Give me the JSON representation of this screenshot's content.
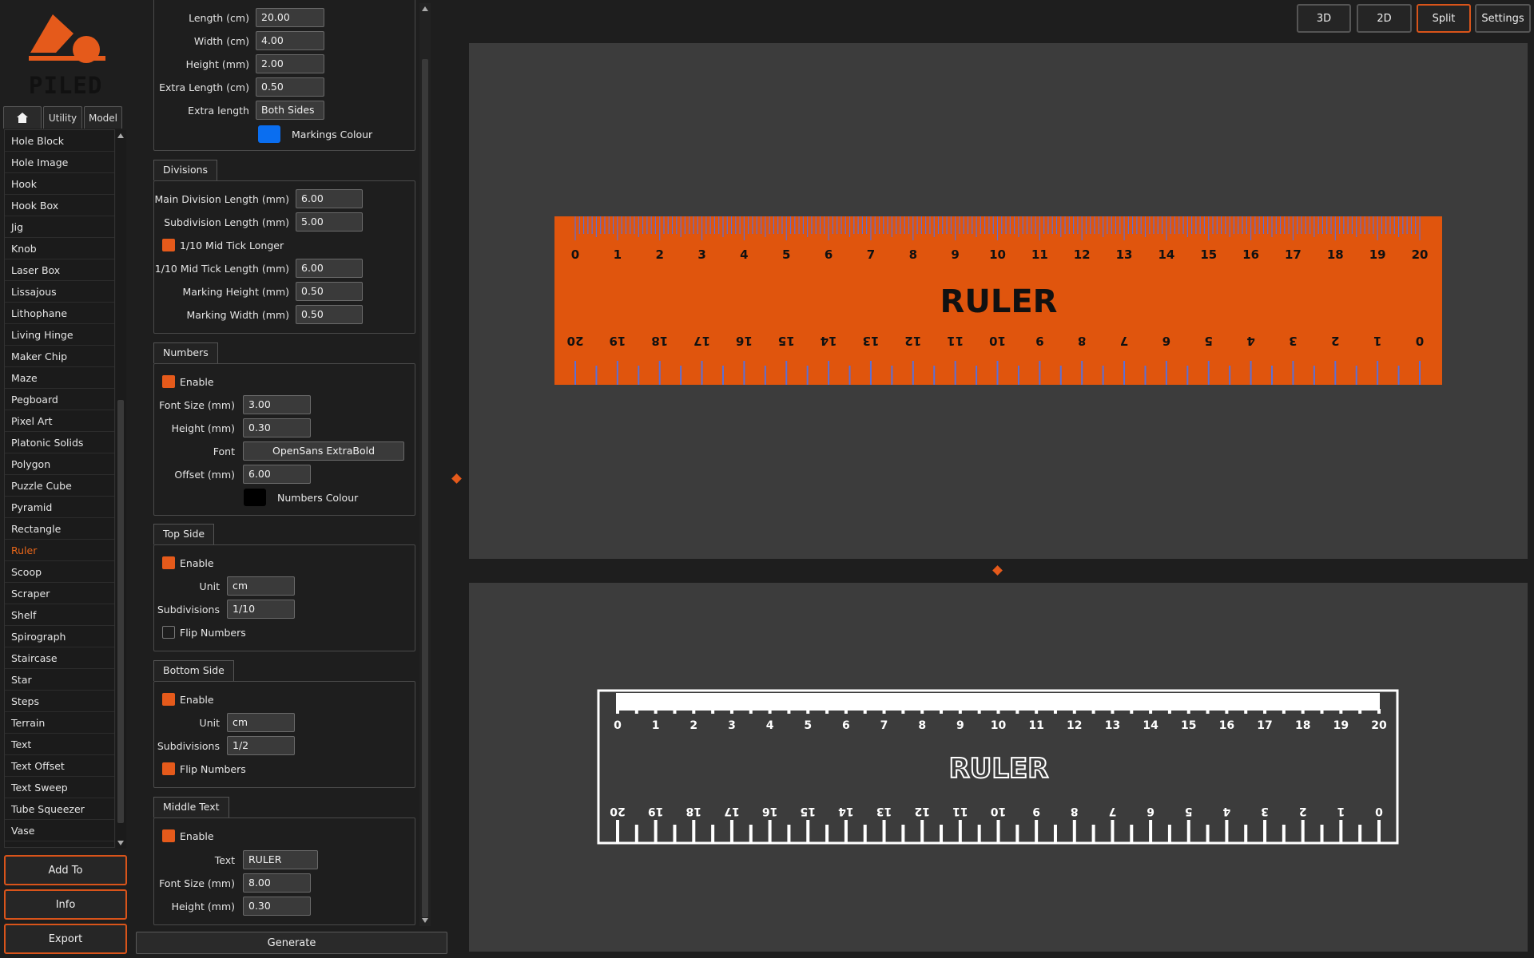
{
  "app": {
    "logo_text": "PILED",
    "accent_color": "#e55a1b"
  },
  "library": {
    "tabs": [
      "",
      "Utility",
      "Model"
    ],
    "items": [
      "Hole Block",
      "Hole Image",
      "Hook",
      "Hook Box",
      "Jig",
      "Knob",
      "Laser Box",
      "Lissajous",
      "Lithophane",
      "Living Hinge",
      "Maker Chip",
      "Maze",
      "Pegboard",
      "Pixel Art",
      "Platonic Solids",
      "Polygon",
      "Puzzle Cube",
      "Pyramid",
      "Rectangle",
      "Ruler",
      "Scoop",
      "Scraper",
      "Shelf",
      "Spirograph",
      "Staircase",
      "Star",
      "Steps",
      "Terrain",
      "Text",
      "Text Offset",
      "Text Sweep",
      "Tube Squeezer",
      "Vase"
    ],
    "selected": "Ruler",
    "buttons": {
      "add_to": "Add To",
      "info": "Info",
      "export": "Export"
    }
  },
  "settings": {
    "general": {
      "length_label": "Length (cm)",
      "length": "20.00",
      "width_label": "Width (cm)",
      "width": "4.00",
      "height_label": "Height (mm)",
      "height": "2.00",
      "extra_length_cm_label": "Extra Length (cm)",
      "extra_length_cm": "0.50",
      "extra_length_label": "Extra length",
      "extra_length": "Both Sides",
      "markings_colour_label": "Markings Colour",
      "markings_colour": "#0a6ef0"
    },
    "divisions": {
      "title": "Divisions",
      "main_division_label": "Main Division Length (mm)",
      "main_division": "6.00",
      "subdivision_label": "Subdivision Length (mm)",
      "subdivision": "5.00",
      "mid_tick_longer_label": "1/10 Mid Tick Longer",
      "mid_tick_longer": true,
      "mid_tick_length_label": "1/10 Mid Tick Length (mm)",
      "mid_tick_length": "6.00",
      "marking_height_label": "Marking Height (mm)",
      "marking_height": "0.50",
      "marking_width_label": "Marking Width (mm)",
      "marking_width": "0.50"
    },
    "numbers": {
      "title": "Numbers",
      "enable_label": "Enable",
      "enable": true,
      "font_size_label": "Font Size (mm)",
      "font_size": "3.00",
      "height_label": "Height (mm)",
      "height": "0.30",
      "font_label": "Font",
      "font": "OpenSans ExtraBold",
      "offset_label": "Offset (mm)",
      "offset": "6.00",
      "colour_label": "Numbers Colour",
      "colour": "#000000"
    },
    "top_side": {
      "title": "Top Side",
      "enable_label": "Enable",
      "enable": true,
      "unit_label": "Unit",
      "unit": "cm",
      "subdivisions_label": "Subdivisions",
      "subdivisions": "1/10",
      "flip_label": "Flip Numbers",
      "flip": false
    },
    "bottom_side": {
      "title": "Bottom Side",
      "enable_label": "Enable",
      "enable": true,
      "unit_label": "Unit",
      "unit": "cm",
      "subdivisions_label": "Subdivisions",
      "subdivisions": "1/2",
      "flip_label": "Flip Numbers",
      "flip": true
    },
    "middle_text": {
      "title": "Middle Text",
      "enable_label": "Enable",
      "enable": true,
      "text_label": "Text",
      "text": "RULER",
      "font_size_label": "Font Size (mm)",
      "font_size": "8.00",
      "height_label": "Height (mm)",
      "height": "0.30"
    },
    "generate_label": "Generate"
  },
  "view": {
    "buttons": [
      "3D",
      "2D",
      "Split",
      "Settings"
    ],
    "active": "Split"
  },
  "preview": {
    "ruler_text": "RULER",
    "body_color": "#e0550d",
    "tick_color": "#5b6fd6",
    "top_numbers": [
      "0",
      "1",
      "2",
      "3",
      "4",
      "5",
      "6",
      "7",
      "8",
      "9",
      "10",
      "11",
      "12",
      "13",
      "14",
      "15",
      "16",
      "17",
      "18",
      "19",
      "20"
    ],
    "bottom_numbers": [
      "20",
      "19",
      "18",
      "17",
      "16",
      "15",
      "14",
      "13",
      "12",
      "11",
      "10",
      "9",
      "8",
      "7",
      "6",
      "5",
      "4",
      "3",
      "2",
      "1",
      "0"
    ]
  }
}
